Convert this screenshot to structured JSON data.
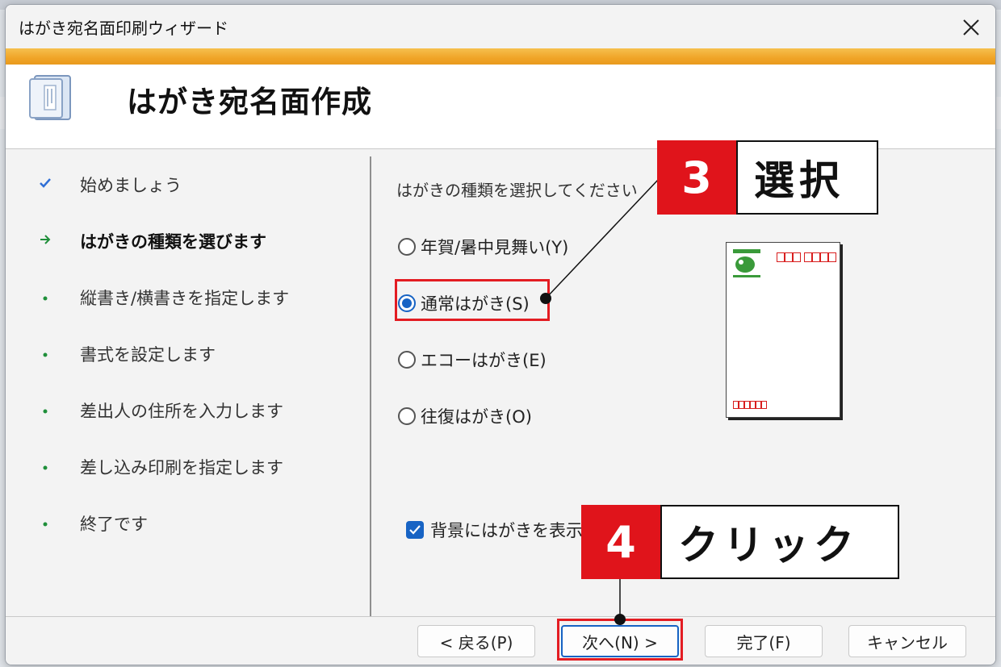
{
  "window": {
    "title": "はがき宛名面印刷ウィザード"
  },
  "header": {
    "title": "はがき宛名面作成"
  },
  "steps": [
    {
      "label": "始めましょう",
      "state": "done"
    },
    {
      "label": "はがきの種類を選びます",
      "state": "current"
    },
    {
      "label": "縦書き/横書きを指定します",
      "state": "pending"
    },
    {
      "label": "書式を設定します",
      "state": "pending"
    },
    {
      "label": "差出人の住所を入力します",
      "state": "pending"
    },
    {
      "label": "差し込み印刷を指定します",
      "state": "pending"
    },
    {
      "label": "終了です",
      "state": "pending"
    }
  ],
  "main": {
    "prompt": "はがきの種類を選択してください",
    "options": [
      {
        "label": "年賀/暑中見舞い(Y)",
        "checked": false
      },
      {
        "label": "通常はがき(S)",
        "checked": true
      },
      {
        "label": "エコーはがき(E)",
        "checked": false
      },
      {
        "label": "往復はがき(O)",
        "checked": false
      }
    ],
    "background_checkbox": {
      "label": "背景にはがきを表示す",
      "checked": true
    }
  },
  "footer": {
    "back": "< 戻る(P)",
    "next": "次へ(N) >",
    "finish": "完了(F)",
    "cancel": "キャンセル"
  },
  "callouts": [
    {
      "number": "3",
      "text": "選択"
    },
    {
      "number": "4",
      "text": "クリック"
    }
  ],
  "colors": {
    "accent": "#1763c4",
    "orange_band": "#f0a427",
    "callout_red": "#e0141b",
    "highlight_red": "#e31c22",
    "done_check": "#2f6fd6",
    "current_arrow": "#1f8f3a",
    "pending_dot": "#1f8f3a"
  },
  "icons": {
    "close": "close-icon",
    "header": "document-wizard-icon",
    "done": "check-icon",
    "current": "arrow-right-icon",
    "pending": "bullet-icon"
  }
}
